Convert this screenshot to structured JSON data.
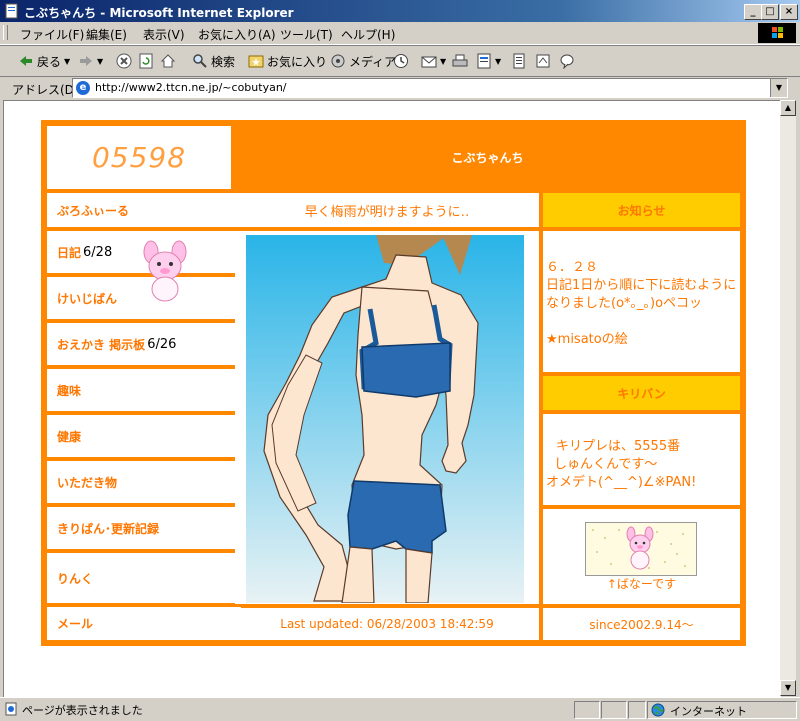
{
  "window": {
    "title": "こぶちゃんち - Microsoft Internet Explorer",
    "minimize": "_",
    "maximize": "□",
    "close": "×"
  },
  "menu": [
    "ファイル(F)",
    "編集(E)",
    "表示(V)",
    "お気に入り(A)",
    "ツール(T)",
    "ヘルプ(H)"
  ],
  "toolbar": {
    "back": "戻る",
    "search": "検索",
    "favorites": "お気に入り",
    "media": "メディア"
  },
  "address": {
    "label": "アドレス(D)",
    "url": "http://www2.ttcn.ne.jp/~cobutyan/"
  },
  "page": {
    "counter": "05598",
    "site_title": "こぶちゃんち",
    "wish": "早く梅雨が明けますように‥",
    "nav": [
      {
        "label": "ぷろふぃーる",
        "date": ""
      },
      {
        "label": "日記",
        "date": "6/28"
      },
      {
        "label": "けいじばん",
        "date": ""
      },
      {
        "label": "おえかき 掲示板",
        "date": "6/26"
      },
      {
        "label": "趣味",
        "date": ""
      },
      {
        "label": "健康",
        "date": ""
      },
      {
        "label": "いただき物",
        "date": ""
      },
      {
        "label": "きりばん･更新記録",
        "date": ""
      },
      {
        "label": "りんく",
        "date": ""
      },
      {
        "label": "メール",
        "date": ""
      }
    ],
    "news_header": "お知らせ",
    "news_date": "６．２８",
    "news_text": "日記1日から順に下に読むようになりました(o*｡_｡)oペコッ",
    "news_item": "★misatoの絵",
    "kiriban_header": "キリバン",
    "kiriban_line1": "キリプレは、5555番",
    "kiriban_line2": "しゅんくんです～",
    "kiriban_line3": "オメデト(^__^)∠※PAN!",
    "banner_caption": "↑ばなーです",
    "last_updated": "Last updated: 06/28/2003 18:42:59",
    "since": "since2002.9.14～"
  },
  "status": {
    "text": "ページが表示されました",
    "zone": "インターネット"
  },
  "colors": {
    "accent": "#ff8800",
    "link": "#ff7700",
    "header_yellow": "#ffcc00"
  }
}
